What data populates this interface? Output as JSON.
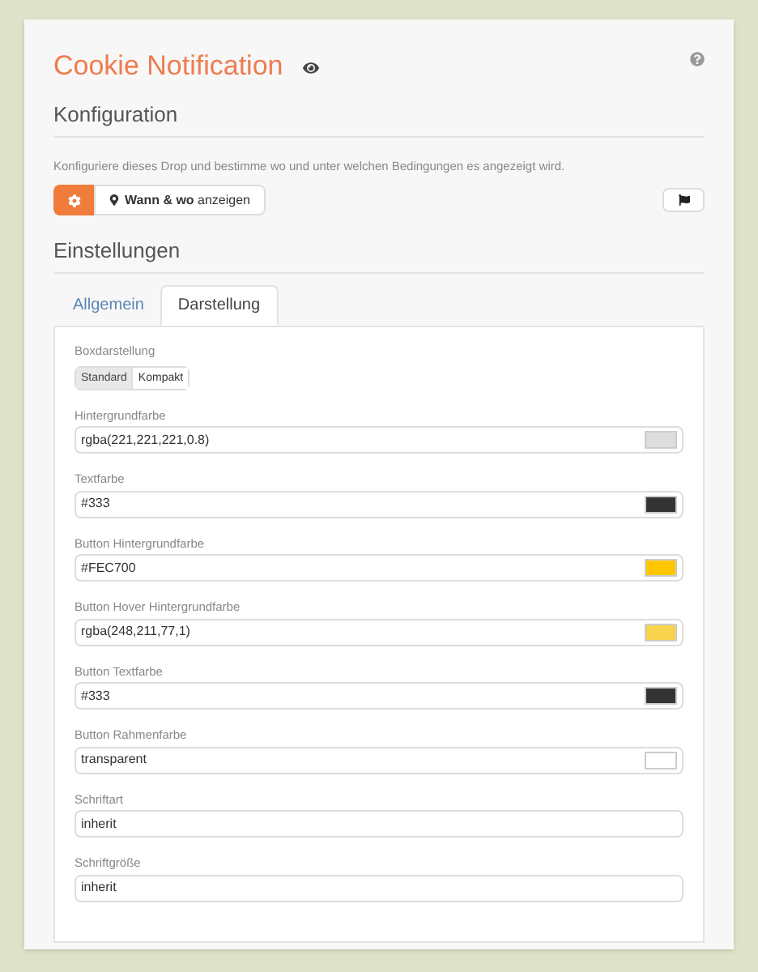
{
  "title": "Cookie Notification",
  "konfiguration": {
    "heading": "Konfiguration",
    "description": "Konfiguriere dieses Drop und bestimme wo und unter welchen Bedingungen es angezeigt wird.",
    "location_button": "**Wann & wo** anzeigen"
  },
  "einstellungen": {
    "heading": "Einstellungen"
  },
  "tabs": [
    {
      "label": "Allgemein",
      "selected": false
    },
    {
      "label": "Darstellung",
      "selected": true
    }
  ],
  "boxdarstellung": {
    "label": "Boxdarstellung",
    "options": [
      {
        "label": "Standard",
        "selected": true
      },
      {
        "label": "Kompakt",
        "selected": false
      }
    ]
  },
  "fields": [
    {
      "label": "Hintergrundfarbe",
      "value": "rgba(221,221,221,0.8)",
      "kind": "color",
      "color": "#dddddd"
    },
    {
      "label": "Textfarbe",
      "value": "#333",
      "kind": "color",
      "color": "#333333"
    },
    {
      "label": "Button Hintergrundfarbe",
      "value": "#FEC700",
      "kind": "color",
      "color": "#fec700"
    },
    {
      "label": "Button Hover Hintergrundfarbe",
      "value": "rgba(248,211,77,1)",
      "kind": "color",
      "color": "#f8d34d"
    },
    {
      "label": "Button Textfarbe",
      "value": "#333",
      "kind": "color",
      "color": "#333333"
    },
    {
      "label": "Button Rahmenfarbe",
      "value": "transparent",
      "kind": "color",
      "color": "#ffffff"
    },
    {
      "label": "Schriftart",
      "value": "inherit",
      "kind": "text"
    },
    {
      "label": "Schriftgröße",
      "value": "inherit",
      "kind": "text"
    }
  ]
}
